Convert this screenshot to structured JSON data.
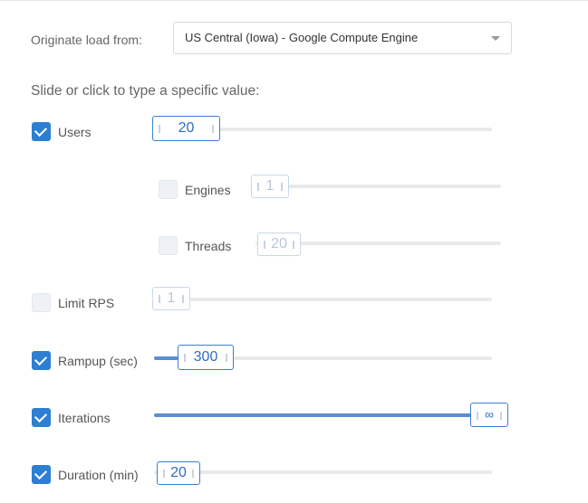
{
  "origin": {
    "label": "Originate load from:",
    "selected": "US Central (Iowa) - Google Compute Engine"
  },
  "hint": "Slide or click to type a specific value:",
  "rows": {
    "users": {
      "label": "Users",
      "checked": true,
      "value": "20",
      "fill": 0.0
    },
    "engines": {
      "label": "Engines",
      "checked": false,
      "value": "1",
      "fill": 0.0
    },
    "threads": {
      "label": "Threads",
      "checked": false,
      "value": "20",
      "fill": 0.0
    },
    "limit_rps": {
      "label": "Limit RPS",
      "checked": false,
      "value": "1",
      "fill": 0.0
    },
    "rampup": {
      "label": "Rampup (sec)",
      "checked": true,
      "value": "300",
      "fill": 0.08
    },
    "iterations": {
      "label": "Iterations",
      "checked": true,
      "value": "∞",
      "fill": 1.0
    },
    "duration": {
      "label": "Duration (min)",
      "checked": true,
      "value": "20",
      "fill": 0.0
    }
  },
  "colors": {
    "accent": "#2d7fd1",
    "track": "#e9e9e9",
    "fill": "#5a8ed3"
  }
}
